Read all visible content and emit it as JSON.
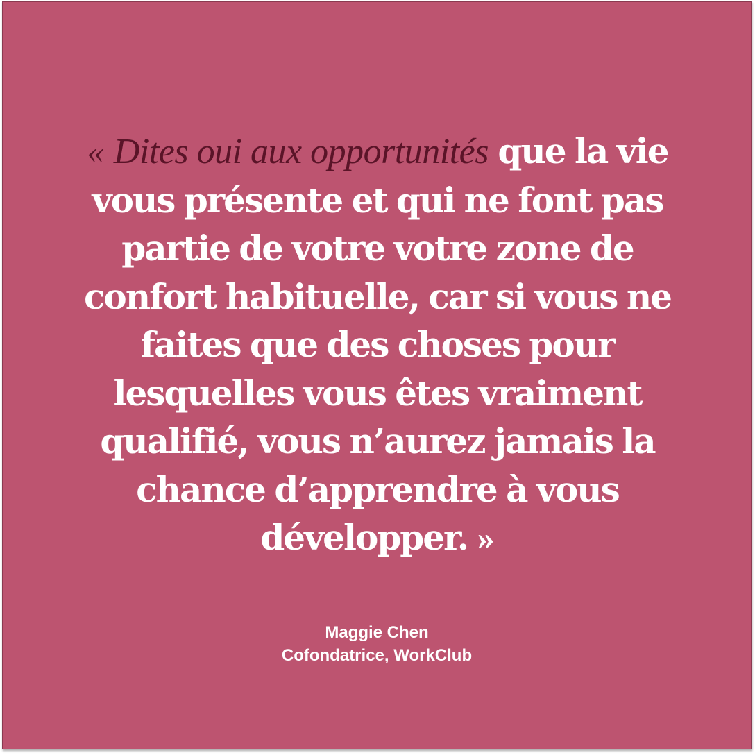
{
  "quote": {
    "open_mark": "«",
    "lead": "Dites oui aux opportunités",
    "body": " que la vie vous présente et qui ne font pas partie de votre votre zone de confort habituelle, car si vous ne faites que des choses pour lesquelles vous êtes vraiment qualifié, vous n’aurez jamais la chance d’apprendre à vous développer.",
    "close_mark": "»"
  },
  "attribution": {
    "name": "Maggie Chen",
    "role": "Cofondatrice, WorkClub"
  },
  "colors": {
    "background": "#bd5470",
    "lead_text": "#5a1428",
    "text": "#ffffff"
  }
}
